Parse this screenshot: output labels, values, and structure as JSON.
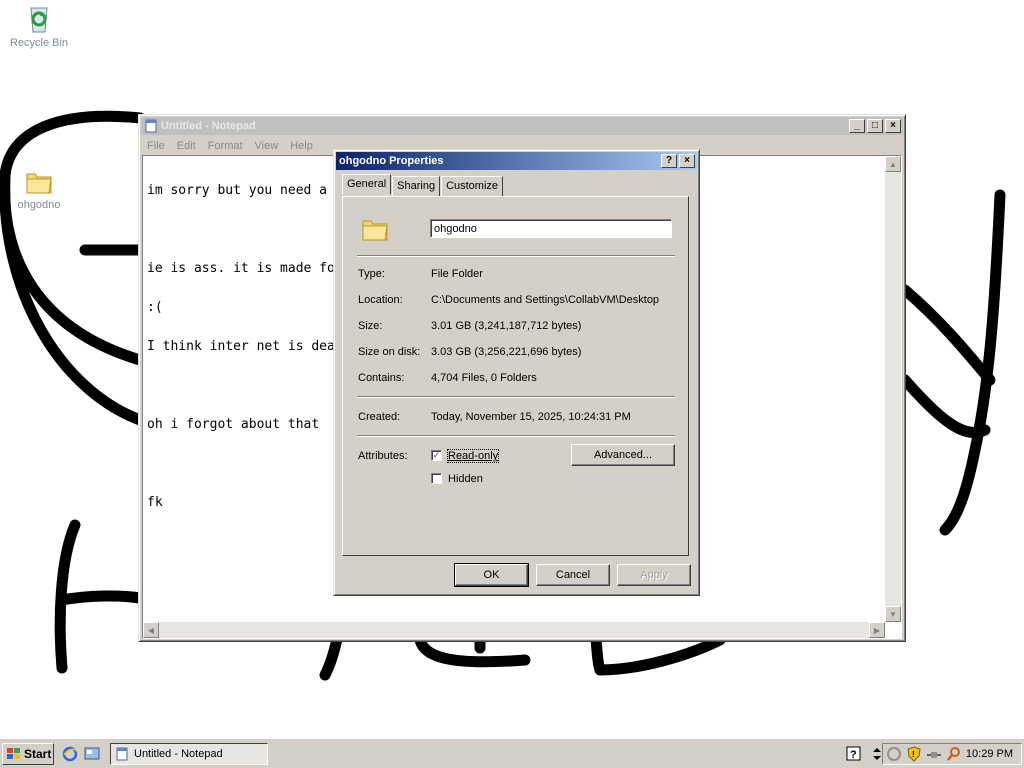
{
  "desktop": {
    "icons": [
      {
        "label": "Recycle Bin",
        "icon": "recycle-bin-icon"
      },
      {
        "label": "ohgodno",
        "icon": "folder-icon"
      }
    ]
  },
  "notepad": {
    "title": "Untitled - Notepad",
    "menu": [
      "File",
      "Edit",
      "Format",
      "View",
      "Help"
    ],
    "lines": [
      "im sorry but you need a",
      "",
      "ie is ass. it is made fo",
      ":(",
      "I think inter net is dea",
      "",
      "oh i forgot about that",
      "",
      "fk"
    ]
  },
  "dialog": {
    "title": "ohgodno Properties",
    "tabs": [
      "General",
      "Sharing",
      "Customize"
    ],
    "name_value": "ohgodno",
    "fields": {
      "type_label": "Type:",
      "type_value": "File Folder",
      "location_label": "Location:",
      "location_value": "C:\\Documents and Settings\\CollabVM\\Desktop",
      "size_label": "Size:",
      "size_value": "3.01 GB (3,241,187,712 bytes)",
      "size_on_disk_label": "Size on disk:",
      "size_on_disk_value": "3.03 GB (3,256,221,696 bytes)",
      "contains_label": "Contains:",
      "contains_value": "4,704 Files, 0 Folders",
      "created_label": "Created:",
      "created_value": "Today, November 15, 2025, 10:24:31 PM",
      "attributes_label": "Attributes:"
    },
    "readonly_label": "Read-only",
    "readonly_checked": true,
    "hidden_label": "Hidden",
    "hidden_checked": false,
    "advanced_label": "Advanced...",
    "ok_label": "OK",
    "cancel_label": "Cancel",
    "apply_label": "Apply"
  },
  "taskbar": {
    "start_label": "Start",
    "task_label": "Untitled - Notepad",
    "clock": "10:29 PM"
  },
  "colors": {
    "active_title": "#0a246a",
    "face": "#d4d0c8"
  }
}
